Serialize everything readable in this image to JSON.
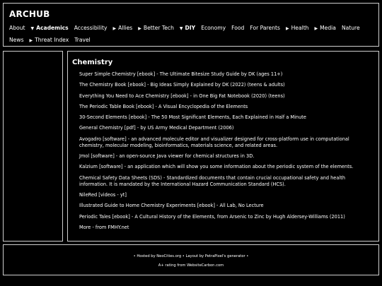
{
  "header": {
    "title": "ARCHUB",
    "nav": [
      {
        "label": "About",
        "caret": ""
      },
      {
        "label": "Academics",
        "caret": "▼",
        "bold": true
      },
      {
        "label": "Accessibility",
        "caret": ""
      },
      {
        "label": "Allies",
        "caret": "▶"
      },
      {
        "label": "Better Tech",
        "caret": "▶"
      },
      {
        "label": "DIY",
        "caret": "▼",
        "bold": true
      },
      {
        "label": "Economy",
        "caret": ""
      },
      {
        "label": "Food",
        "caret": ""
      },
      {
        "label": "For Parents",
        "caret": ""
      },
      {
        "label": "Health",
        "caret": "▶"
      },
      {
        "label": "Media",
        "caret": "▶"
      },
      {
        "label": "Nature",
        "caret": ""
      },
      {
        "label": "News",
        "caret": ""
      },
      {
        "label": "Threat Index",
        "caret": "▶"
      },
      {
        "label": "Travel",
        "caret": ""
      }
    ]
  },
  "main": {
    "title": "Chemistry",
    "links": [
      {
        "name": "Super Simple Chemistry",
        "desc": " [ebook] - The Ultimate Bitesize Study Guide by DK (ages 11+)"
      },
      {
        "name": "The Chemistry Book",
        "desc": " [ebook] - Big Ideas Simply Explained by DK (2022) (teens & adults)"
      },
      {
        "name": "Everything You Need to Ace Chemistry",
        "desc": " [ebook] - in One Big Fat Notebook (2020) (teens)"
      },
      {
        "name": "The Periodic Table Book",
        "desc": " [ebook] - A Visual Encyclopedia of the Elements"
      },
      {
        "name": "30-Second Elements",
        "desc": " [ebook] - The 50 Most Significant Elements, Each Explained in Half a Minute"
      },
      {
        "name": "General Chemistry",
        "desc": " [pdf] - by US Army Medical Department (2006)"
      },
      {
        "name": "Avogadro",
        "desc": " [software] - an advanced molecule editor and visualizer designed for cross-platform use in computational chemistry, molecular modeling, bioinformatics, materials science, and related areas."
      },
      {
        "name": "Jmol",
        "desc": " [software] - an open-source Java viewer for chemical structures in 3D."
      },
      {
        "name": "Kalzium",
        "desc": " [software] - an application which will show you some information about the periodic system of the elements."
      },
      {
        "name": "Chemical Safety Data Sheets (SDS)",
        "desc": " - Standardized documents that contain crucial occupational safety and health information. It is mandated by the International Hazard Communication Standard (HCS)."
      },
      {
        "name": "NileRed",
        "desc": " [videos - yt]"
      },
      {
        "name": "Illustrated Guide to Home Chemistry Experiments",
        "desc": " [ebook] - All Lab, No Lecture"
      },
      {
        "name": "Periodic Tales",
        "desc": " [ebook] - A Cultural History of the Elements, from Arsenic to Zinc by Hugh Aldersey-Williams (2011)"
      },
      {
        "name": "More",
        "desc": " - from FMHY.net"
      }
    ]
  },
  "footer": {
    "line1": "• Hosted by NeoCities.org • Layout by PetraPixel's generator •",
    "line2": "A+ rating from WebsiteCarbon.com"
  }
}
